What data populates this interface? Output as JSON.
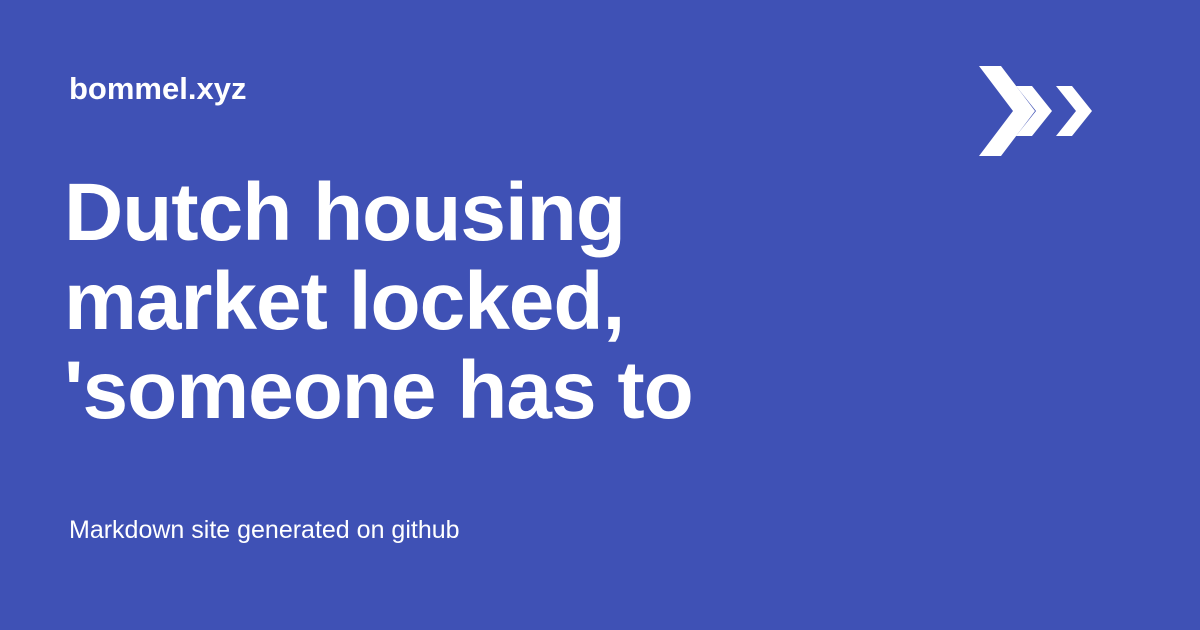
{
  "site": {
    "name": "bommel.xyz",
    "logo_icon": "triple-chevron-right-icon"
  },
  "headline": {
    "lines": [
      "Dutch housing",
      "market locked,",
      "'someone has to"
    ]
  },
  "footer": {
    "text": "Markdown site generated on github"
  },
  "colors": {
    "background": "#3f51b5",
    "foreground": "#ffffff"
  }
}
